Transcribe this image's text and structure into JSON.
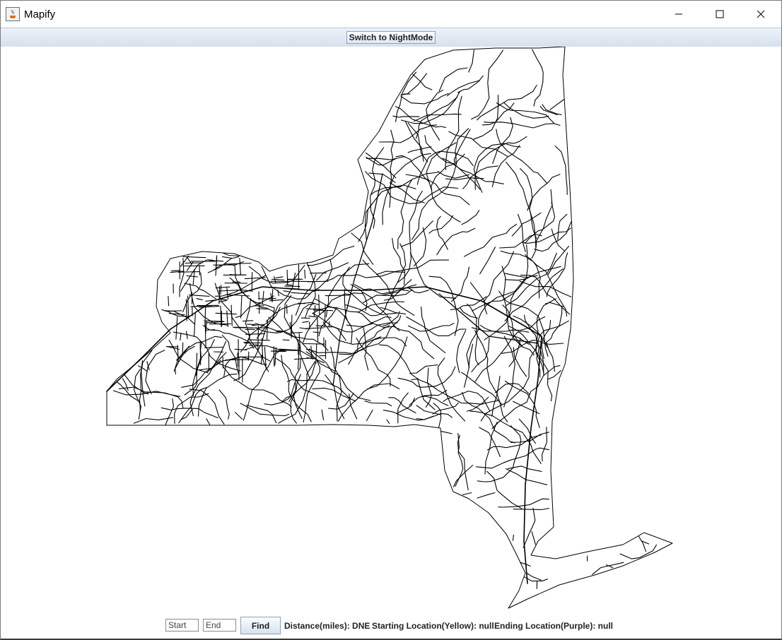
{
  "window": {
    "title": "Mapify",
    "icon": "java-icon",
    "controls": [
      "minimize-icon",
      "maximize-icon",
      "close-icon"
    ]
  },
  "toolbar": {
    "night_mode_label": "Switch to NightMode"
  },
  "map": {
    "line_color": "#000000",
    "background": "#ffffff"
  },
  "controls": {
    "start_placeholder": "Start",
    "end_placeholder": "End",
    "find_label": "Find",
    "distance_label": "Distance(miles): DNE",
    "start_location_label": "Starting Location(Yellow): null",
    "end_location_label": "Ending Location(Purple): null"
  }
}
